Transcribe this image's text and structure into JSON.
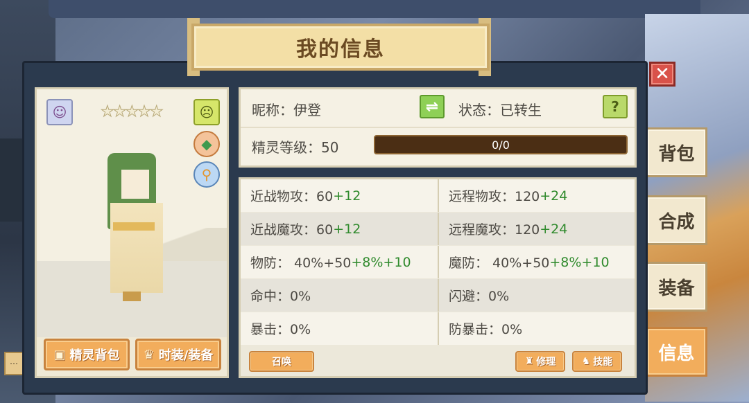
{
  "window": {
    "title": "我的信息",
    "close_label": "✕"
  },
  "character_panel": {
    "stars": "★★★★★",
    "icons": [
      "avatar-icon",
      "face-icon",
      "gem-icon",
      "magnify-icon"
    ],
    "buttons": {
      "sprite_bag": "精灵背包",
      "fashion_equipment": "时装/装备"
    }
  },
  "info": {
    "nickname": "昵称：伊登",
    "status": "状态：已转生",
    "level": "精灵等级：50",
    "exp_text": "0/0",
    "exp_progress": 0,
    "swap_label": "⇌",
    "help_label": "?"
  },
  "stats": {
    "rows": [
      {
        "left_base": "近战物攻：60",
        "left_bonus": "+12",
        "right_base": "远程物攻：120",
        "right_bonus": "+24"
      },
      {
        "left_base": "近战魔攻：60",
        "left_bonus": "+12",
        "right_base": "远程魔攻：120",
        "right_bonus": "+24"
      },
      {
        "left_base": "物防： 40%+50",
        "left_bonus": "+8%+10",
        "right_base": "魔防： 40%+50",
        "right_bonus": "+8%+10"
      },
      {
        "left_base": "命中：0%",
        "left_bonus": "",
        "right_base": "闪避：0%",
        "right_bonus": ""
      },
      {
        "left_base": "暴击：0%",
        "left_bonus": "",
        "right_base": "防暴击：0%",
        "right_bonus": ""
      }
    ],
    "buttons": {
      "summon": "召唤",
      "repair": "修理",
      "skill": "技能"
    }
  },
  "side_tabs": {
    "bag": "背包",
    "craft": "合成",
    "equip": "装备",
    "info": "信息",
    "active": "信息"
  },
  "colors": {
    "accent_orange": "#f2ad5c",
    "bonus_green": "#2f8a2c",
    "panel_bg": "#f5f1e4",
    "window_bg": "#2b3a4e"
  }
}
